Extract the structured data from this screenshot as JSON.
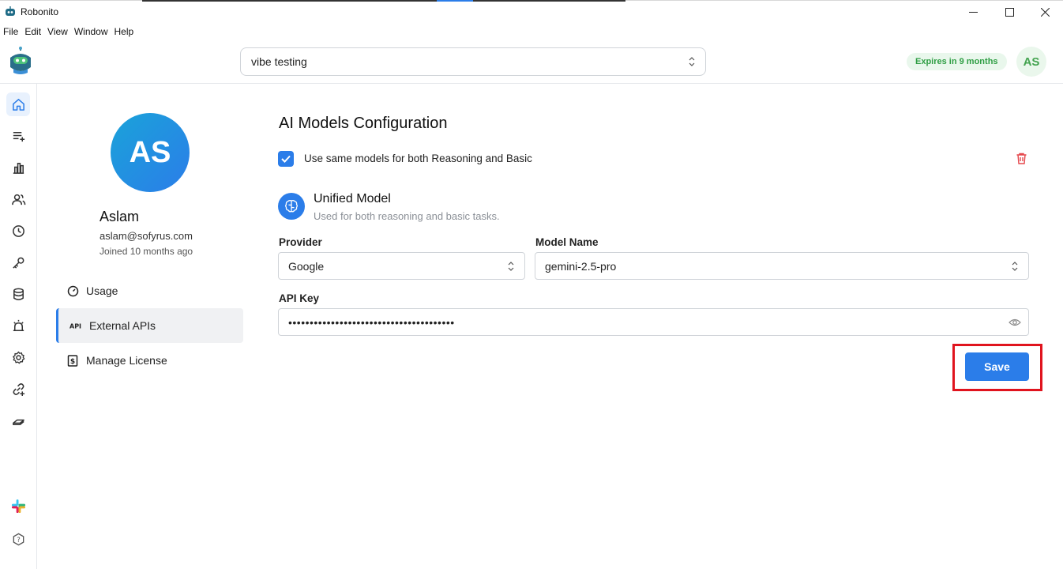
{
  "window": {
    "title": "Robonito",
    "controls": {
      "minimize": "—",
      "maximize": "☐",
      "close": "✕"
    }
  },
  "menu": [
    "File",
    "Edit",
    "View",
    "Window",
    "Help"
  ],
  "header": {
    "project_select_value": "vibe testing",
    "expiry_badge": "Expires in 9 months",
    "avatar_initials": "AS"
  },
  "rail": {
    "items": [
      "home-icon",
      "list-add-icon",
      "bar-chart-icon",
      "users-icon",
      "clock-icon",
      "key-icon",
      "database-icon",
      "alarm-icon",
      "settings-icon",
      "link-add-icon",
      "layers-icon"
    ],
    "bottom": [
      "slack-icon",
      "help-hexagon-icon"
    ]
  },
  "profile": {
    "initials": "AS",
    "name": "Aslam",
    "email": "aslam@sofyrus.com",
    "joined": "Joined 10 months ago",
    "nav": [
      {
        "label": "Usage",
        "icon": "gauge-icon"
      },
      {
        "label": "External APIs",
        "icon": "api-icon"
      },
      {
        "label": "Manage License",
        "icon": "license-icon"
      }
    ],
    "active_nav": "External APIs"
  },
  "config": {
    "title": "AI Models Configuration",
    "same_models_checkbox_label": "Use same models for both Reasoning and Basic",
    "same_models_checked": true,
    "model_title": "Unified Model",
    "model_subtitle": "Used for both reasoning and basic tasks.",
    "provider_label": "Provider",
    "provider_value": "Google",
    "model_name_label": "Model Name",
    "model_name_value": "gemini-2.5-pro",
    "api_key_label": "API Key",
    "api_key_masked": "•••••••••••••••••••••••••••••••••••••••",
    "save_label": "Save"
  },
  "colors": {
    "accent": "#2b7de9",
    "badge_green_text": "#2f9e44",
    "badge_green_bg": "#e9f7ec",
    "highlight_red": "#e0141e",
    "trash_red": "#e5484d"
  }
}
